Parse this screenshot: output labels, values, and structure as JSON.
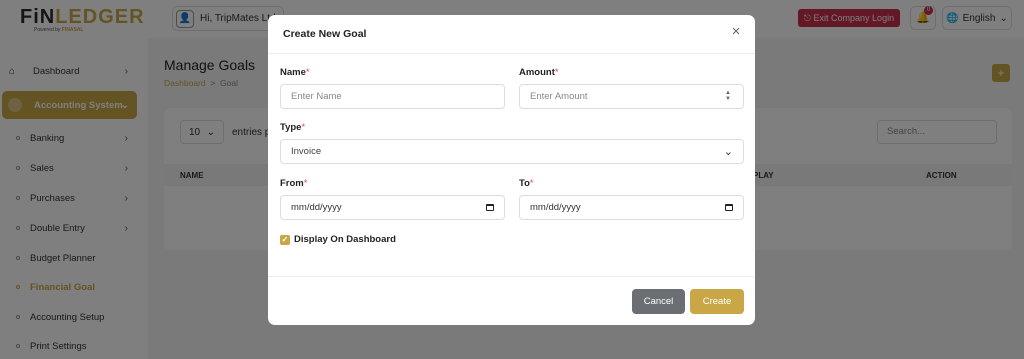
{
  "brand": {
    "logo_text_a": "FiN",
    "logo_text_b": "LEDGER",
    "logo_sub_a": "Powered by ",
    "logo_sub_b": "FINASAL"
  },
  "sidebar": {
    "items": [
      {
        "label": "Dashboard"
      },
      {
        "label": "Accounting System"
      },
      {
        "label": "Banking"
      },
      {
        "label": "Sales"
      },
      {
        "label": "Purchases"
      },
      {
        "label": "Double Entry"
      },
      {
        "label": "Budget Planner"
      },
      {
        "label": "Financial Goal"
      },
      {
        "label": "Accounting Setup"
      },
      {
        "label": "Print Settings"
      }
    ]
  },
  "topbar": {
    "greeting": "Hi, TripMates Ltd",
    "exit_label": "Exit Company Login",
    "notif_count": "0",
    "language": "English"
  },
  "page": {
    "title": "Manage Goals",
    "breadcrumb_home": "Dashboard",
    "breadcrumb_sep": ">",
    "breadcrumb_current": "Goal",
    "add_label": "+"
  },
  "table": {
    "entries_value": "10",
    "entries_label": "entries p",
    "search_placeholder": "Search...",
    "columns": [
      "NAME",
      "PLAY",
      "ACTION"
    ]
  },
  "modal": {
    "title": "Create New Goal",
    "close_label": "×",
    "name": {
      "label": "Name",
      "placeholder": "Enter Name"
    },
    "amount": {
      "label": "Amount",
      "placeholder": "Enter Amount"
    },
    "type": {
      "label": "Type",
      "value": "Invoice"
    },
    "from": {
      "label": "From",
      "value": "mm/dd/yyyy"
    },
    "to": {
      "label": "To",
      "value": "mm/dd/yyyy"
    },
    "display_on_dashboard": {
      "label": "Display On Dashboard",
      "checked": true
    },
    "required_mark": "*",
    "cancel_label": "Cancel",
    "create_label": "Create"
  },
  "colors": {
    "accent": "#c9a646",
    "danger": "#c9304a",
    "cancel": "#6b6f74"
  }
}
